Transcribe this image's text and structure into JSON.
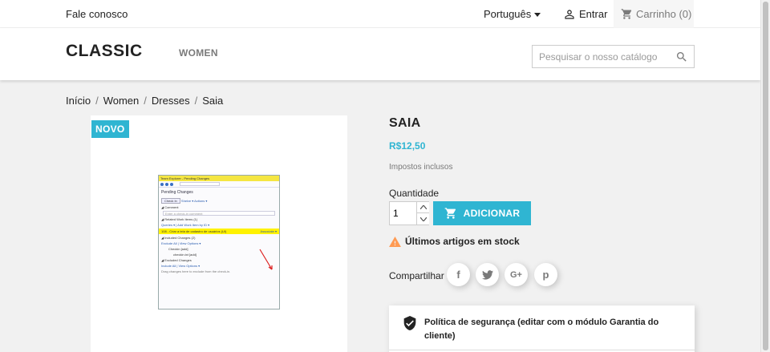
{
  "topbar": {
    "contact": "Fale conosco",
    "language": "Português",
    "login": "Entrar",
    "cart": "Carrinho (0)"
  },
  "header": {
    "logo": "CLASSIC",
    "menu": [
      "WOMEN"
    ],
    "search_placeholder": "Pesquisar o nosso catálogo"
  },
  "breadcrumb": [
    "Início",
    "Women",
    "Dresses",
    "Saia"
  ],
  "product": {
    "badge": "NOVO",
    "title": "SAIA",
    "price": "R$12,50",
    "tax": "Impostos inclusos",
    "quantity_label": "Quantidade",
    "quantity_value": "1",
    "add_button": "ADICIONAR",
    "stock_message": "Últimos artigos em stock",
    "share_label": "Compartilhar",
    "social": [
      "f",
      "t",
      "G+",
      "p"
    ],
    "policy": "Política de segurança (editar com o módulo Garantia do cliente)"
  },
  "embedded_screenshot": {
    "titlebar": "Team Explorer - Pending Changes",
    "search": "Search Work Items (Ctrl+')",
    "heading": "Pending Changes",
    "checkin_button": "Check In",
    "actions": "Shelve ▾   Actions ▾",
    "comment_section": "◢ Comment",
    "comment_placeholder": "Enter a check-in comment",
    "related_section": "◢ Related Work Items (1)",
    "related_links": "Queries ▾ | Add Work Item by ID ▾",
    "work_item": "108 - Criar a tela de cadastro de usuários (UI)",
    "associate": "Associate ▾",
    "included_section": "◢ Included Changes (2)",
    "included_links": "Exclude All | View Options ▾",
    "file_checkin": "Checkin [add]",
    "file_checkin_txt": "checkin.txt [add]",
    "excluded_section": "◢ Excluded Changes",
    "excluded_links": "Include All | View Options ▾",
    "excluded_hint": "Drag changes here to exclude from the check-in."
  },
  "colors": {
    "accent": "#2fb5d2",
    "warning": "#ff9a52",
    "text": "#232323",
    "muted": "#7a7a7a"
  }
}
